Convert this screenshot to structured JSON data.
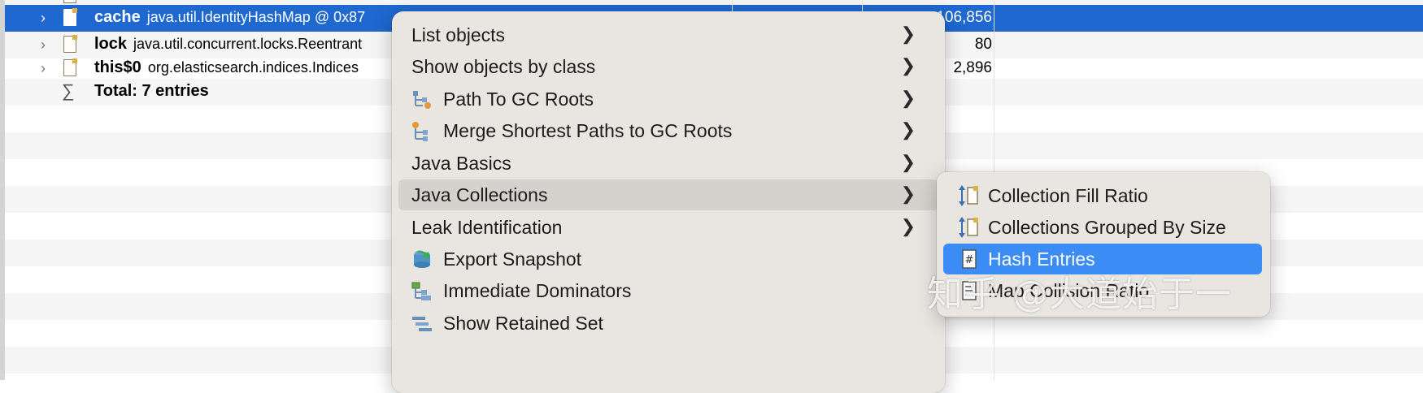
{
  "table": {
    "rows": [
      {
        "name": "cache",
        "type": "java.util.IdentityHashMap @ 0x87",
        "value": "106,856",
        "selected": true
      },
      {
        "name": "lock",
        "type": "java.util.concurrent.locks.Reentrant",
        "value": "80"
      },
      {
        "name": "this$0",
        "type": "org.elasticsearch.indices.Indices",
        "value": "2,896"
      }
    ],
    "total_label": "Total: 7 entries"
  },
  "context_menu": {
    "items": [
      {
        "label": "List objects",
        "has_submenu": true
      },
      {
        "label": "Show objects by class",
        "has_submenu": true
      },
      {
        "label": "Path To GC Roots",
        "icon": "path-gc-roots-icon",
        "has_submenu": true
      },
      {
        "label": "Merge Shortest Paths to GC Roots",
        "icon": "merge-paths-icon",
        "has_submenu": true
      },
      {
        "label": "Java Basics",
        "has_submenu": true
      },
      {
        "label": "Java Collections",
        "has_submenu": true,
        "highlighted": true
      },
      {
        "label": "Leak Identification",
        "has_submenu": true
      },
      {
        "label": "Export Snapshot",
        "icon": "export-snapshot-icon"
      },
      {
        "label": "Immediate Dominators",
        "icon": "immediate-dominators-icon"
      },
      {
        "label": "Show Retained Set",
        "icon": "retained-set-icon"
      }
    ]
  },
  "submenu": {
    "items": [
      {
        "label": "Collection Fill Ratio",
        "icon": "fill-ratio-icon"
      },
      {
        "label": "Collections Grouped By Size",
        "icon": "grouped-size-icon"
      },
      {
        "label": "Hash Entries",
        "icon": "hash-entries-icon",
        "active": true
      },
      {
        "label": "Map Collision Ratio",
        "icon": "collision-ratio-icon"
      }
    ]
  },
  "watermark": "知乎 @大道始于一",
  "colors": {
    "selection": "#1e68d0",
    "menu_bg": "#e9e6e2",
    "menu_highlight": "#d5d2ce",
    "submenu_active": "#3b8cf5"
  }
}
